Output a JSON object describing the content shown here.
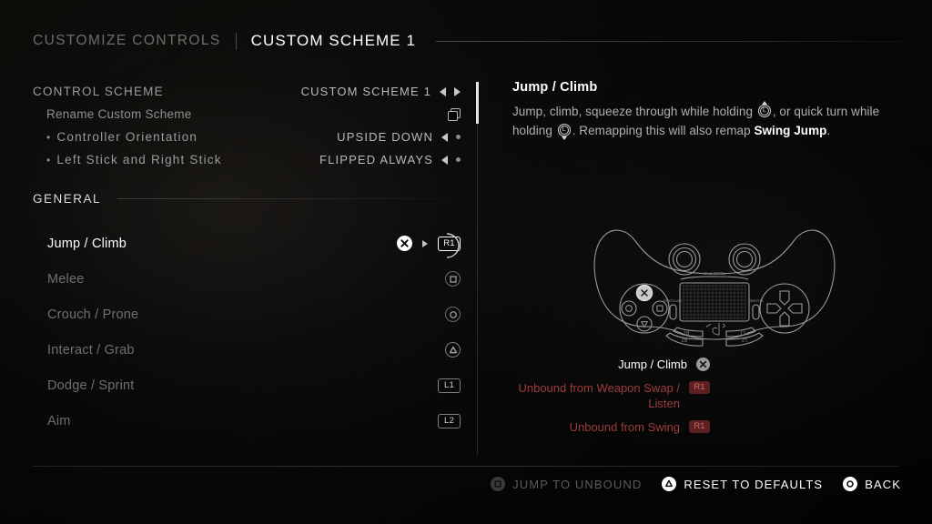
{
  "header": {
    "breadcrumb_parent": "CUSTOMIZE CONTROLS",
    "breadcrumb_current": "CUSTOM SCHEME 1"
  },
  "options": [
    {
      "label": "CONTROL SCHEME",
      "value": "CUSTOM SCHEME 1",
      "control": "arrows",
      "style": "caps"
    },
    {
      "label": "Rename Custom Scheme",
      "value": "",
      "control": "copy",
      "style": "sub"
    },
    {
      "label": "Controller Orientation",
      "value": "UPSIDE DOWN",
      "control": "arrowdot",
      "style": "bullet"
    },
    {
      "label": "Left Stick and Right Stick",
      "value": "FLIPPED ALWAYS",
      "control": "arrowdot",
      "style": "bullet"
    }
  ],
  "section": {
    "label": "GENERAL"
  },
  "bindings": [
    {
      "name": "Jump / Climb",
      "glyph": "cross",
      "chip": "R1",
      "selected": true
    },
    {
      "name": "Melee",
      "glyph": "square",
      "chip": "",
      "selected": false
    },
    {
      "name": "Crouch / Prone",
      "glyph": "circle",
      "chip": "",
      "selected": false
    },
    {
      "name": "Interact / Grab",
      "glyph": "triangle",
      "chip": "",
      "selected": false
    },
    {
      "name": "Dodge / Sprint",
      "glyph": "",
      "chip": "L1",
      "selected": false
    },
    {
      "name": "Aim",
      "glyph": "",
      "chip": "L2",
      "selected": false
    }
  ],
  "detail": {
    "title": "Jump / Climb",
    "desc_part1": "Jump, climb, squeeze through while holding ",
    "stick1_label": "L",
    "desc_part2": ", or quick turn while holding ",
    "stick2_label": "L",
    "desc_part3": ". Remapping this will also remap ",
    "desc_bold": "Swing Jump",
    "desc_part4": "."
  },
  "controller": {
    "label_share": "SHARE",
    "label_options": "OPTIONS",
    "label_touchpad": "TOUCHPAD",
    "shoulder_left_top": "L2",
    "shoulder_left_bottom": "L1",
    "shoulder_right_top": "R2",
    "shoulder_right_bottom": "R1"
  },
  "legend": [
    {
      "text": "Jump / Climb",
      "chip": "",
      "glyph": "cross",
      "unbound": false
    },
    {
      "text": "Unbound from Weapon Swap / Listen",
      "chip": "R1",
      "glyph": "",
      "unbound": true
    },
    {
      "text": "Unbound from Swing",
      "chip": "R1",
      "glyph": "",
      "unbound": true
    }
  ],
  "footer": [
    {
      "label": "JUMP TO UNBOUND",
      "glyph": "square",
      "dim": true
    },
    {
      "label": "RESET TO DEFAULTS",
      "glyph": "triangle",
      "dim": false
    },
    {
      "label": "BACK",
      "glyph": "circle",
      "dim": false
    }
  ],
  "colors": {
    "accent_white": "#ffffff",
    "dim_text": "#6f6f6f",
    "unbound_red": "#9d3c3c",
    "chip_red_bg": "#5d2020"
  }
}
